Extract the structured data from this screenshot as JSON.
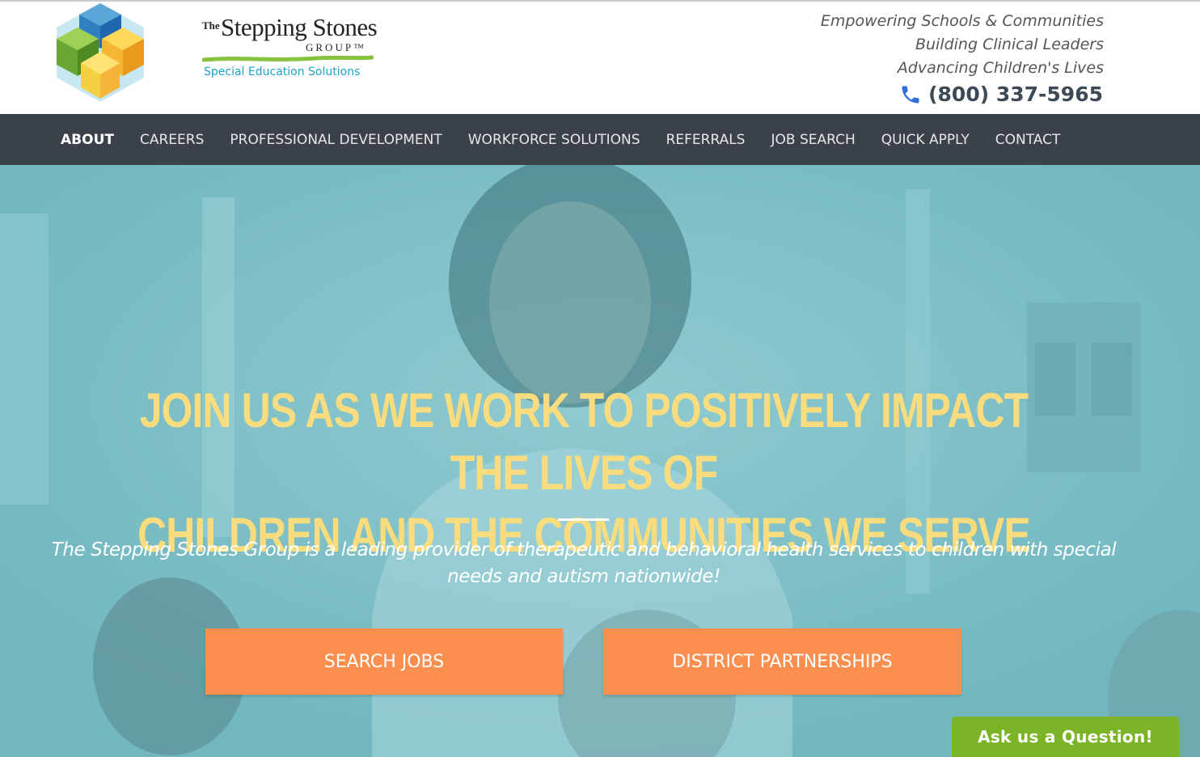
{
  "logo": {
    "the": "The",
    "name": "Stepping Stones",
    "group": "GROUP™",
    "subtitle": "Special Education Solutions"
  },
  "header": {
    "taglines": [
      "Empowering Schools & Communities",
      "Building Clinical Leaders",
      "Advancing Children's Lives"
    ],
    "phone": "(800) 337-5965",
    "phone_icon": "phone-icon"
  },
  "nav": {
    "items": [
      {
        "label": "ABOUT",
        "active": true
      },
      {
        "label": "CAREERS"
      },
      {
        "label": "PROFESSIONAL DEVELOPMENT"
      },
      {
        "label": "WORKFORCE SOLUTIONS"
      },
      {
        "label": "REFERRALS"
      },
      {
        "label": "JOB SEARCH"
      },
      {
        "label": "QUICK APPLY"
      },
      {
        "label": "CONTACT"
      }
    ]
  },
  "hero": {
    "title_line1": "JOIN US AS WE WORK TO POSITIVELY IMPACT THE LIVES OF",
    "title_line2": "CHILDREN AND THE COMMUNITIES WE SERVE",
    "description": "The Stepping Stones Group is a leading provider of therapeutic and behavioral health services to children with special needs and autism nationwide!",
    "buttons": {
      "search_jobs": "SEARCH JOBS",
      "district_partnerships": "DISTRICT PARTNERSHIPS"
    }
  },
  "chat": {
    "label": "Ask us a Question!"
  },
  "colors": {
    "nav_bg": "#3a4149",
    "hero_overlay": "#7fc2c9",
    "hero_title": "#f8dc7d",
    "cta": "#fa8f4f",
    "chat": "#7bb527",
    "phone_icon": "#2f6fd6"
  }
}
